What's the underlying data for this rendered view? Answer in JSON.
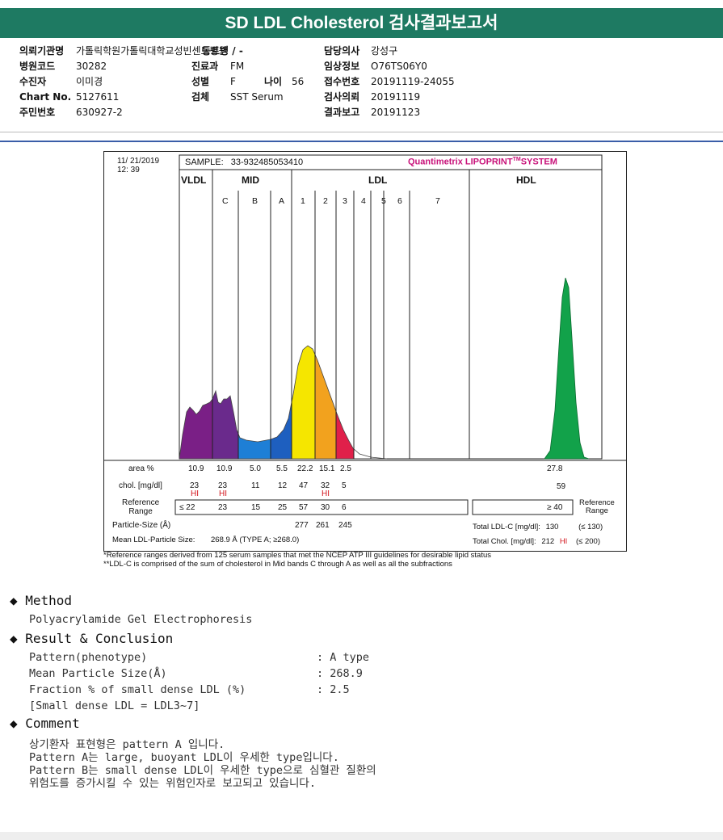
{
  "title": "SD LDL Cholesterol 검사결과보고서",
  "info": {
    "col1": [
      {
        "key": "의뢰기관명",
        "value": "가톨릭학원가톨릭대학교성빈센트병원"
      },
      {
        "key": "병원코드",
        "value": "30282"
      },
      {
        "key": "수진자",
        "value": "이미경"
      },
      {
        "key": "Chart No.",
        "value": "5127611"
      },
      {
        "key": "주민번호",
        "value": "630927-2"
      }
    ],
    "col2_top": "동트병 / -",
    "col2": [
      {
        "key": "진료과",
        "value": "FM"
      },
      {
        "key": "성별",
        "value": "F"
      },
      {
        "key": "검체",
        "value": "SST Serum"
      }
    ],
    "age": {
      "key": "나이",
      "value": "56"
    },
    "col3": [
      {
        "key": "담당의사",
        "value": "강성구"
      },
      {
        "key": "임상정보",
        "value": "O76TS06Y0"
      },
      {
        "key": "접수번호",
        "value": "20191119-24055"
      },
      {
        "key": "검사의뢰",
        "value": "20191119"
      },
      {
        "key": "결과보고",
        "value": "20191123"
      }
    ]
  },
  "chart": {
    "date": "11/ 21/2019",
    "time": "12: 39",
    "sample_label": "SAMPLE:",
    "sample_value": "33-932485053410",
    "brand_pre": "Quantimetrix LIPOPRINT",
    "brand_tm": "TM",
    "brand_post": "SYSTEM",
    "groups": {
      "vldl": "VLDL",
      "mid": "MID",
      "ldl": "LDL",
      "hdl": "HDL"
    },
    "bands": [
      "C",
      "B",
      "A",
      "1",
      "2",
      "3",
      "4",
      "5",
      "6",
      "7"
    ],
    "row_labels": {
      "area": "area %",
      "chol": "chol. [mg/dl]",
      "ref_line1": "Reference",
      "ref_line2": "Range",
      "particle": "Particle-Size (Å)",
      "mean": "Mean LDL-Particle Size:"
    },
    "area_values": [
      "10.9",
      "10.9",
      "5.0",
      "5.5",
      "22.2",
      "15.1",
      "2.5"
    ],
    "hdl_area": "27.8",
    "chol_values": [
      "23",
      "23",
      "11",
      "12",
      "47",
      "32",
      "5"
    ],
    "hdl_chol": "59",
    "hi_flag": "HI",
    "ref_values": [
      "≤ 22",
      "23",
      "15",
      "25",
      "57",
      "30",
      "6"
    ],
    "hdl_ref": "≥ 40",
    "ref_right_1": "Reference",
    "ref_right_2": "Range",
    "particle_values": [
      "277",
      "261",
      "245"
    ],
    "mean_value": "268.9 Å   (TYPE A; ≥268.0)",
    "total_ldl_label": "Total LDL-C [mg/dl]:",
    "total_ldl_value": "130",
    "total_ldl_ref": "(≤ 130)",
    "total_chol_label": "Total Chol. [mg/dl]:",
    "total_chol_value": "212",
    "total_chol_flag": "HI",
    "total_chol_ref": "(≤ 200)",
    "colors": {
      "vldl": "#7a1f86",
      "mid_c": "#6a2a8c",
      "mid_b": "#1e7fd6",
      "mid_a": "#1e5fbf",
      "ldl1": "#f5e600",
      "ldl2": "#f2a21e",
      "ldl3": "#e0204a",
      "hdl": "#12a24a",
      "hi": "#d2141c",
      "brand": "#c8127a"
    }
  },
  "footnotes": [
    "*Reference ranges derived from 125 serum samples that met the NCEP ATP III guidelines for desirable lipid status",
    "**LDL-C is comprised of the sum of cholesterol in Mid bands C through A as well as all the subfractions"
  ],
  "method": {
    "heading": "Method",
    "text": "Polyacrylamide Gel Electrophoresis"
  },
  "result": {
    "heading": "Result & Conclusion",
    "rows": [
      {
        "label": "Pattern(phenotype)",
        "value": "A type"
      },
      {
        "label": "Mean Particle Size(Å)",
        "value": "268.9"
      },
      {
        "label": "Fraction % of small dense LDL (%)",
        "value": "2.5"
      }
    ],
    "note": "[Small dense LDL = LDL3~7]"
  },
  "comment": {
    "heading": "Comment",
    "lines": [
      "상기환자 표현형은 pattern A 입니다.",
      "Pattern A는 large, buoyant LDL이 우세한 type입니다.",
      "Pattern B는 small dense LDL이 우세한 type으로 심혈관 질환의",
      "위험도를 증가시킬 수 있는 위험인자로 보고되고 있습니다."
    ]
  }
}
